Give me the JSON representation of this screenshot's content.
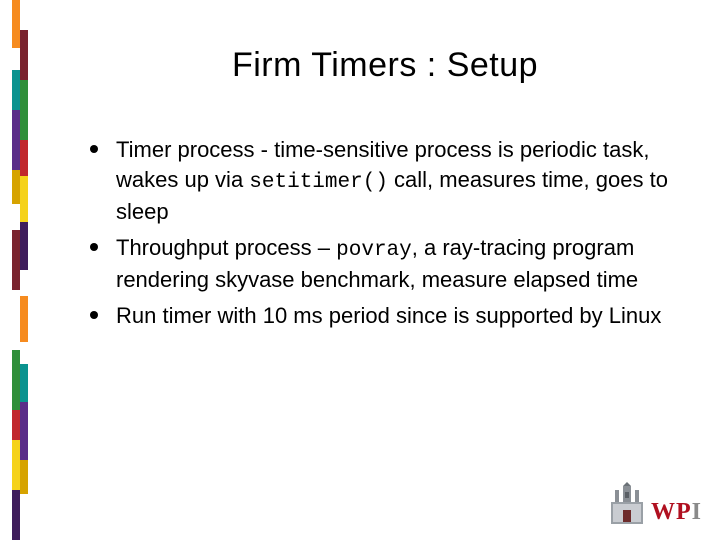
{
  "slide": {
    "title": "Firm Timers : Setup",
    "bullets": [
      {
        "pre": "Timer process - time-sensitive process is periodic task, wakes up via ",
        "code": "setitimer()",
        "post": " call, measures time, goes to sleep"
      },
      {
        "pre": "Throughput process – ",
        "code": "povray",
        "post": ", a ray-tracing program rendering skyvase benchmark, measure elapsed time"
      },
      {
        "pre": "Run timer with 10 ms period since is supported by Linux",
        "code": "",
        "post": ""
      }
    ]
  },
  "logo": {
    "text_w": "W",
    "text_p": "P",
    "text_i": "I"
  }
}
